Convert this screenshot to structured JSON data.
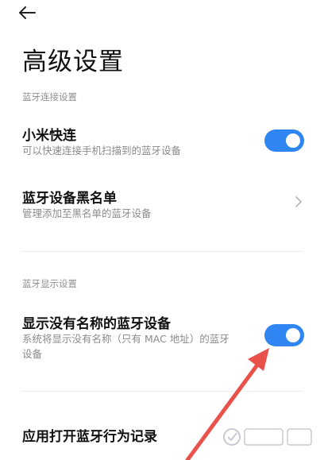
{
  "header": {
    "back_icon": "back-arrow-icon"
  },
  "page_title": "高级设置",
  "sections": [
    {
      "header": "蓝牙连接设置",
      "items": [
        {
          "title": "小米快连",
          "subtitle": "可以快速连接手机扫描到的蓝牙设备",
          "control": "toggle",
          "enabled": true
        },
        {
          "title": "蓝牙设备黑名单",
          "subtitle": "管理添加至黑名单的蓝牙设备",
          "control": "chevron-right-icon"
        }
      ]
    },
    {
      "header": "蓝牙显示设置",
      "items": [
        {
          "title": "显示没有名称的蓝牙设备",
          "subtitle_line1": "系统将显示没有名称（只有 MAC 地址）的蓝牙",
          "subtitle_line2": "设备",
          "control": "toggle",
          "enabled": true
        }
      ]
    }
  ],
  "bottom_item": {
    "title": "应用打开蓝牙行为记录"
  },
  "colors": {
    "accent": "#2f86f3",
    "annotation_arrow": "#e8524a"
  },
  "annotation": {
    "icon": "red-pointer-arrow-icon"
  },
  "watermark": {
    "icon": "baidu-jingyan-watermark"
  }
}
